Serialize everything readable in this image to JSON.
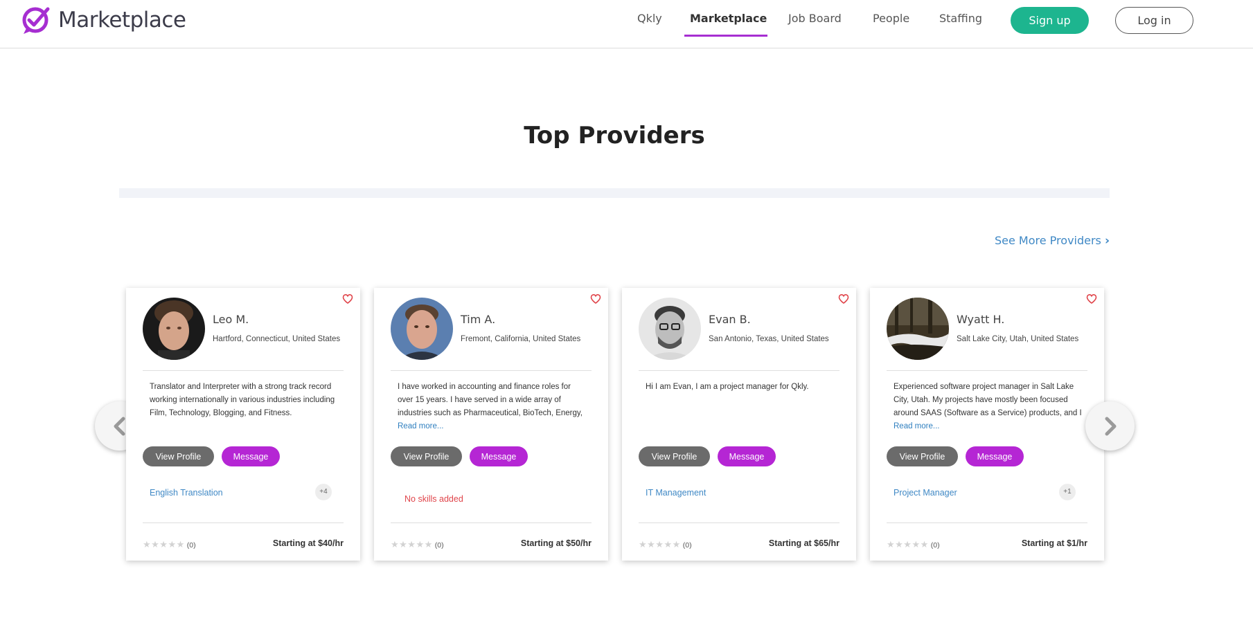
{
  "brand": {
    "name": "Marketplace",
    "accent": "#a62ed1"
  },
  "nav": {
    "items": [
      {
        "label": "Qkly"
      },
      {
        "label": "Marketplace",
        "active": true
      },
      {
        "label": "Job Board"
      },
      {
        "label": "People"
      },
      {
        "label": "Staffing"
      }
    ],
    "signup_label": "Sign up",
    "login_label": "Log in",
    "signup_color": "#1db58f"
  },
  "section": {
    "title": "Top Providers",
    "see_more_label": "See More Providers"
  },
  "providers": [
    {
      "name": "Leo M.",
      "location": "Hartford, Connecticut, United States",
      "bio": "Translator and Interpreter with a strong track record working internationally in various industries including Film, Technology, Blogging, and Fitness.",
      "read_more": "",
      "view_label": "View Profile",
      "message_label": "Message",
      "skill": "English Translation",
      "more_skills": "+4",
      "rating_count": "(0)",
      "price": "Starting at $40/hr"
    },
    {
      "name": "Tim A.",
      "location": "Fremont, California, United States",
      "bio": "I have worked in accounting and finance roles for over 15 years. I have served in a wide array of industries such as Pharmaceutical, BioTech, Energy,",
      "read_more": "Read more...",
      "view_label": "View Profile",
      "message_label": "Message",
      "skill": "No skills added",
      "more_skills": "",
      "rating_count": "(0)",
      "price": "Starting at $50/hr"
    },
    {
      "name": "Evan B.",
      "location": "San Antonio, Texas, United States",
      "bio": "Hi I am Evan, I am a project manager for Qkly.",
      "read_more": "",
      "view_label": "View Profile",
      "message_label": "Message",
      "skill": "IT Management",
      "more_skills": "",
      "rating_count": "(0)",
      "price": "Starting at $65/hr"
    },
    {
      "name": "Wyatt H.",
      "location": "Salt Lake City, Utah, United States",
      "bio": "Experienced software project manager in Salt Lake City, Utah. My projects have mostly been focused around SAAS (Software as a Service) products, and I",
      "read_more": "Read more...",
      "view_label": "View Profile",
      "message_label": "Message",
      "skill": "Project Manager",
      "more_skills": "+1",
      "rating_count": "(0)",
      "price": "Starting at $1/hr"
    }
  ],
  "rating": {
    "stars_filled": 0,
    "stars_total": 5
  },
  "icons": {
    "logo": "marketplace-logo-icon",
    "favorite": "heart-outline-icon",
    "prev": "chevron-left-icon",
    "next": "chevron-right-icon"
  }
}
